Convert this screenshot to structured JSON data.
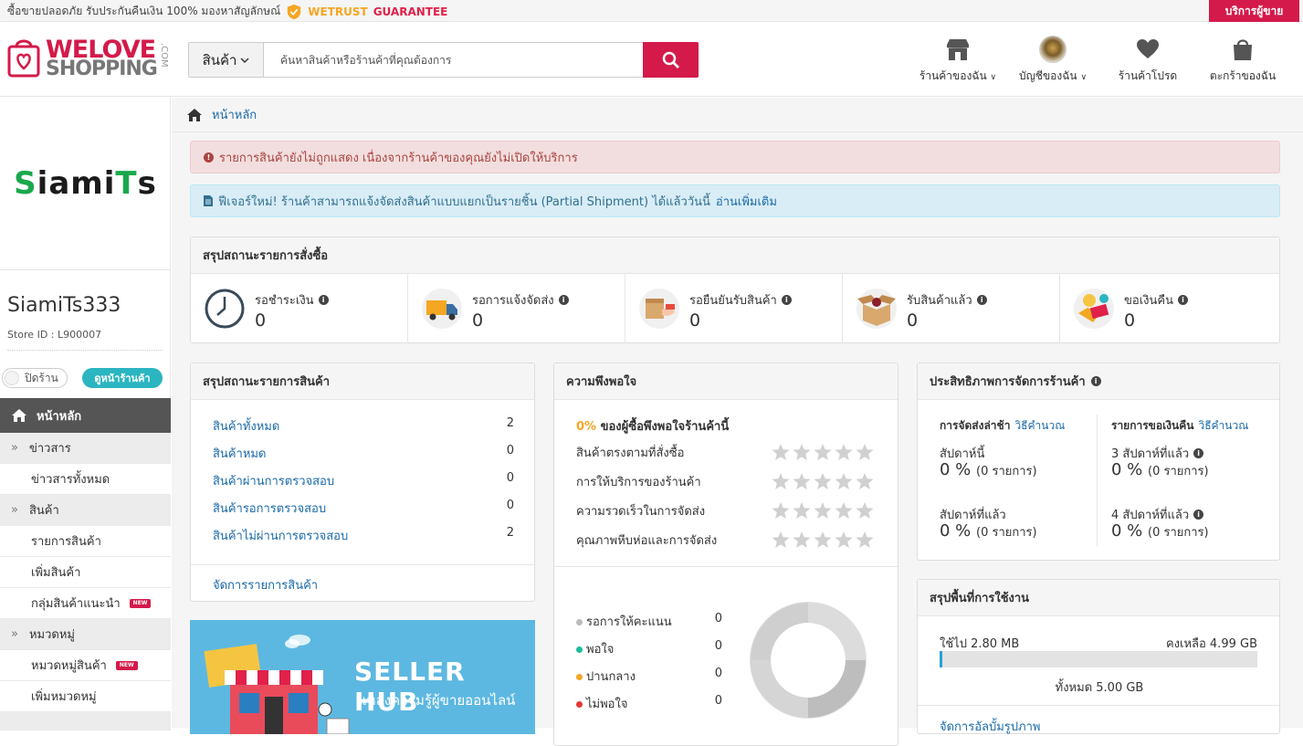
{
  "topbar": {
    "promo": "ซื้อขายปลอดภัย รับประกันคืนเงิน 100% มองหาสัญลักษณ์",
    "wetrust": "WETRUST",
    "guarantee": "GUARANTEE",
    "seller_service": "บริการผู้ขาย"
  },
  "logo": {
    "line1": "WELOVE",
    "line2": "SHOPPING",
    "suffix": ".COM"
  },
  "search": {
    "category": "สินค้า",
    "placeholder": "ค้นหาสินค้าหรือร้านค้าที่คุณต้องการ"
  },
  "header_nav": [
    {
      "label": "ร้านค้าของฉัน",
      "icon": "store-icon"
    },
    {
      "label": "บัญชีของฉัน",
      "icon": "avatar"
    },
    {
      "label": "ร้านค้าโปรด",
      "icon": "heart-icon"
    },
    {
      "label": "ตะกร้าของฉัน",
      "icon": "cart-icon"
    }
  ],
  "sidebar": {
    "shop_logo_green": "S",
    "shop_logo_mid": "iami",
    "shop_logo_green2": "T",
    "shop_logo_end": "s",
    "shop_name": "SiamiTs333",
    "store_id": "Store ID : L900007",
    "toggle_label": "ปิดร้าน",
    "view_shop": "ดูหน้าร้านค้า",
    "home": "หน้าหลัก",
    "sections": [
      {
        "label": "ข่าวสาร",
        "items": [
          {
            "label": "ข่าวสารทั้งหมด",
            "new": false
          }
        ]
      },
      {
        "label": "สินค้า",
        "items": [
          {
            "label": "รายการสินค้า",
            "new": false
          },
          {
            "label": "เพิ่มสินค้า",
            "new": false
          },
          {
            "label": "กลุ่มสินค้าแนะนำ",
            "new": true
          }
        ]
      },
      {
        "label": "หมวดหมู่",
        "items": [
          {
            "label": "หมวดหมู่สินค้า",
            "new": true
          },
          {
            "label": "เพิ่มหมวดหมู่",
            "new": false
          }
        ]
      }
    ],
    "new_badge": "NEW"
  },
  "breadcrumb": {
    "home": "หน้าหลัก"
  },
  "alerts": {
    "error": "รายการสินค้ายังไม่ถูกแสดง เนื่องจากร้านค้าของคุณยังไม่เปิดให้บริการ",
    "info": "ฟีเจอร์ใหม่! ร้านค้าสามารถแจ้งจัดส่งสินค้าแบบแยกเป็นรายชิ้น (Partial Shipment) ได้แล้ววันนี้",
    "info_link": "อ่านเพิ่มเติม"
  },
  "order_summary": {
    "title": "สรุปสถานะรายการสั่งซื้อ",
    "items": [
      {
        "label": "รอชำระเงิน",
        "value": "0",
        "icon": "clock-icon"
      },
      {
        "label": "รอการแจ้งจัดส่ง",
        "value": "0",
        "icon": "truck-icon"
      },
      {
        "label": "รอยืนยันรับสินค้า",
        "value": "0",
        "icon": "package-hand-icon"
      },
      {
        "label": "รับสินค้าแล้ว",
        "value": "0",
        "icon": "open-box-icon"
      },
      {
        "label": "ขอเงินคืน",
        "value": "0",
        "icon": "refund-icon"
      }
    ]
  },
  "product_summary": {
    "title": "สรุปสถานะรายการสินค้า",
    "rows": [
      {
        "label": "สินค้าทั้งหมด",
        "value": "2"
      },
      {
        "label": "สินค้าหมด",
        "value": "0"
      },
      {
        "label": "สินค้าผ่านการตรวจสอบ",
        "value": "0"
      },
      {
        "label": "สินค้ารอการตรวจสอบ",
        "value": "0"
      },
      {
        "label": "สินค้าไม่ผ่านการตรวจสอบ",
        "value": "2"
      }
    ],
    "manage_link": "จัดการรายการสินค้า"
  },
  "satisfaction": {
    "title": "ความพึงพอใจ",
    "percent": "0%",
    "percent_text": " ของผู้ซื้อพึงพอใจร้านค้านี้",
    "criteria": [
      {
        "label": "สินค้าตรงตามที่สั่งซื้อ",
        "stars": 0
      },
      {
        "label": "การให้บริการของร้านค้า",
        "stars": 0
      },
      {
        "label": "ความรวดเร็วในการจัดส่ง",
        "stars": 0
      },
      {
        "label": "คุณภาพหีบห่อและการจัดส่ง",
        "stars": 0
      }
    ],
    "legend": [
      {
        "label": "รอการให้คะแนน",
        "value": "0",
        "color": "#bbbbbb"
      },
      {
        "label": "พอใจ",
        "value": "0",
        "color": "#1abc9c"
      },
      {
        "label": "ปานกลาง",
        "value": "0",
        "color": "#f5a623"
      },
      {
        "label": "ไม่พอใจ",
        "value": "0",
        "color": "#e53935"
      }
    ]
  },
  "performance": {
    "title": "ประสิทธิภาพการจัดการร้านค้า",
    "left_title": "การจัดส่งล่าช้า",
    "right_title": "รายการขอเงินคืน",
    "how_link": "วิธีคำนวณ",
    "left": [
      {
        "label": "สัปดาห์นี้",
        "value": "0 %",
        "count": "(0 รายการ)"
      },
      {
        "label": "สัปดาห์ที่แล้ว",
        "value": "0 %",
        "count": "(0 รายการ)"
      }
    ],
    "right": [
      {
        "label": "3 สัปดาห์ที่แล้ว",
        "value": "0 %",
        "count": "(0 รายการ)"
      },
      {
        "label": "4 สัปดาห์ที่แล้ว",
        "value": "0 %",
        "count": "(0 รายการ)"
      }
    ]
  },
  "space": {
    "title": "สรุปพื้นที่การใช้งาน",
    "used": "ใช้ไป 2.80 MB",
    "remaining": "คงเหลือ 4.99 GB",
    "total": "ทั้งหมด 5.00 GB",
    "used_fraction": 0.0056,
    "manage_link": "จัดการอัลบั้มรูปภาพ"
  },
  "banner": {
    "title": "SELLER HUB",
    "subtitle": "แหล่งความรู้ผู้ขายออนไลน์"
  },
  "colors": {
    "brand": "#d41a4a",
    "link": "#1a6aa8",
    "teal": "#2bb5c0"
  }
}
